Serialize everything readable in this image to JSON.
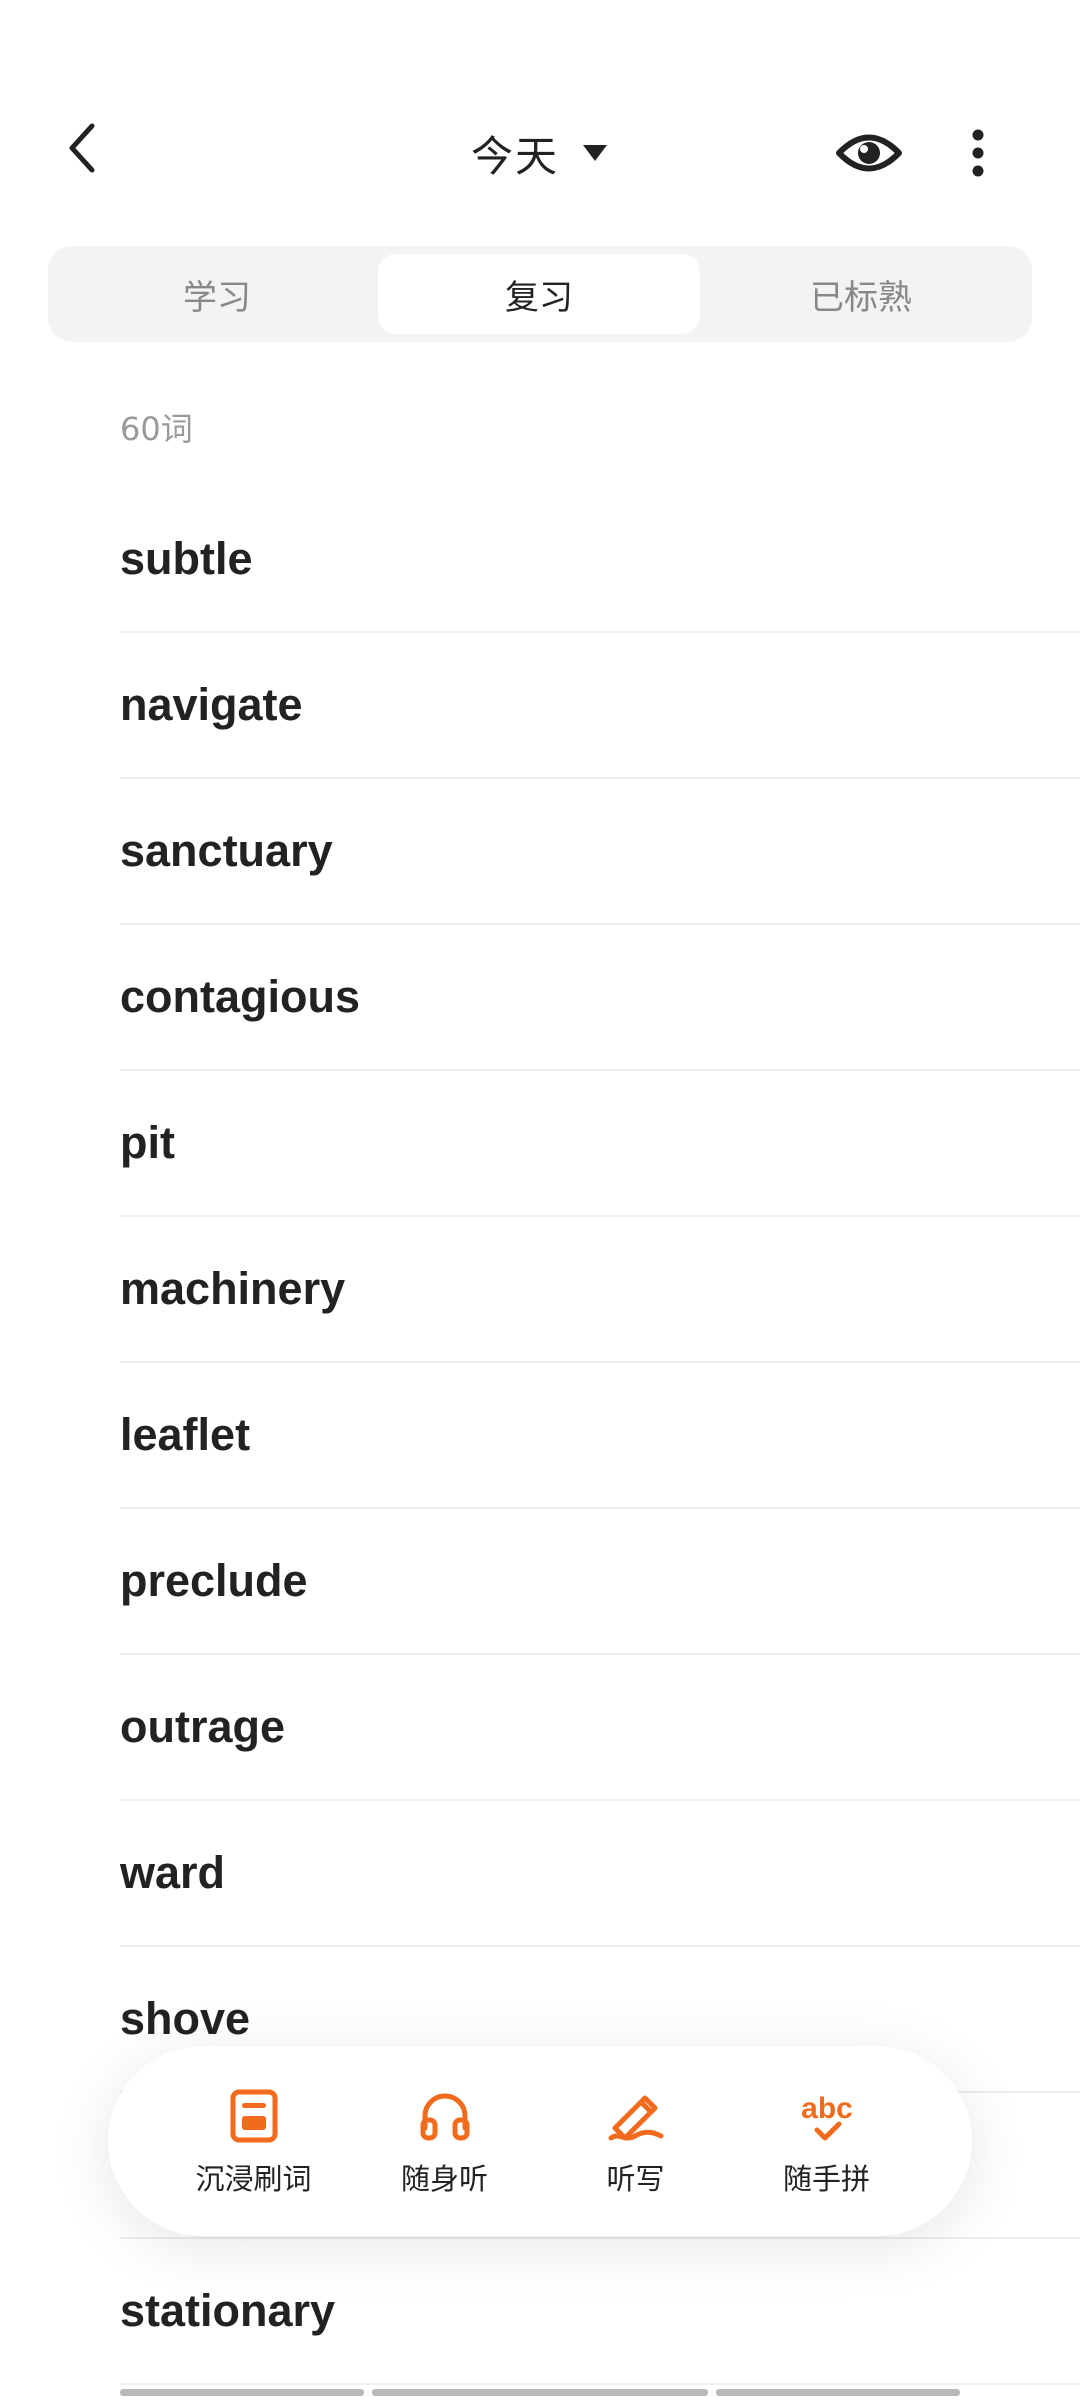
{
  "header": {
    "title": "今天",
    "back_icon": "chevron-left-icon",
    "title_dropdown_icon": "caret-down-icon",
    "eye_icon": "eye-icon",
    "more_icon": "more-vertical-icon"
  },
  "tabs": [
    {
      "label": "学习",
      "selected": false
    },
    {
      "label": "复习",
      "selected": true
    },
    {
      "label": "已标熟",
      "selected": false
    }
  ],
  "word_count": "60词",
  "words": [
    "subtle",
    "navigate",
    "sanctuary",
    "contagious",
    "pit",
    "machinery",
    "leaflet",
    "preclude",
    "outrage",
    "ward",
    "shove",
    "",
    "stationary"
  ],
  "actions": [
    {
      "label": "沉浸刷词",
      "icon": "document-card-icon"
    },
    {
      "label": "随身听",
      "icon": "headphones-icon"
    },
    {
      "label": "听写",
      "icon": "pencil-icon"
    },
    {
      "label": "随手拼",
      "icon": "abc-check-icon"
    }
  ],
  "colors": {
    "accent": "#F26B1D",
    "text": "#222222",
    "muted": "#888888",
    "segment_bg": "#F3F3F3",
    "divider": "#EEEEEE"
  }
}
